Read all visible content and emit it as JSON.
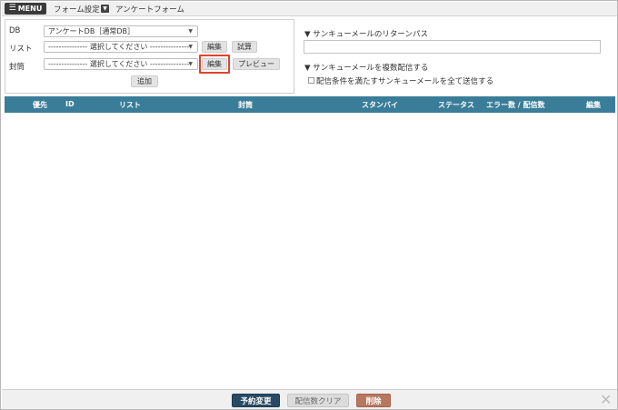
{
  "topbar": {
    "menu_label": "MENU",
    "menu_icon": "hamburger-icon",
    "breadcrumb": [
      "フォーム設定",
      "アンケートフォーム"
    ]
  },
  "form": {
    "db": {
      "label": "DB",
      "value": "アンケートDB［通常DB］"
    },
    "list": {
      "label": "リスト",
      "value": "--------------- 選択してください ---------------",
      "edit_label": "編集",
      "calc_label": "試算"
    },
    "envelope": {
      "label": "封筒",
      "value": "--------------- 選択してください ---------------",
      "edit_label": "編集",
      "preview_label": "プレビュー"
    },
    "add_label": "追加"
  },
  "thanks": {
    "return_path_title": "▼ サンキューメールのリターンパス",
    "return_path_value": "",
    "multi_title": "▼ サンキューメールを複数配信する",
    "multi_checkbox_label": "配信条件を満たすサンキューメールを全て送信する",
    "multi_checked": false
  },
  "table": {
    "columns": [
      "優先",
      "ID",
      "リスト",
      "封筒",
      "スタンバイ",
      "ステータス",
      "エラー数 / 配信数",
      "編集"
    ],
    "rows": []
  },
  "footer": {
    "reserve_label": "予約変更",
    "clear_label": "配信数クリア",
    "delete_label": "削除",
    "close_icon": "close-icon"
  },
  "colors": {
    "header_bg": "#3a7d98",
    "primary": "#2a4a63",
    "danger": "#b97760",
    "highlight": "#e0442e"
  }
}
